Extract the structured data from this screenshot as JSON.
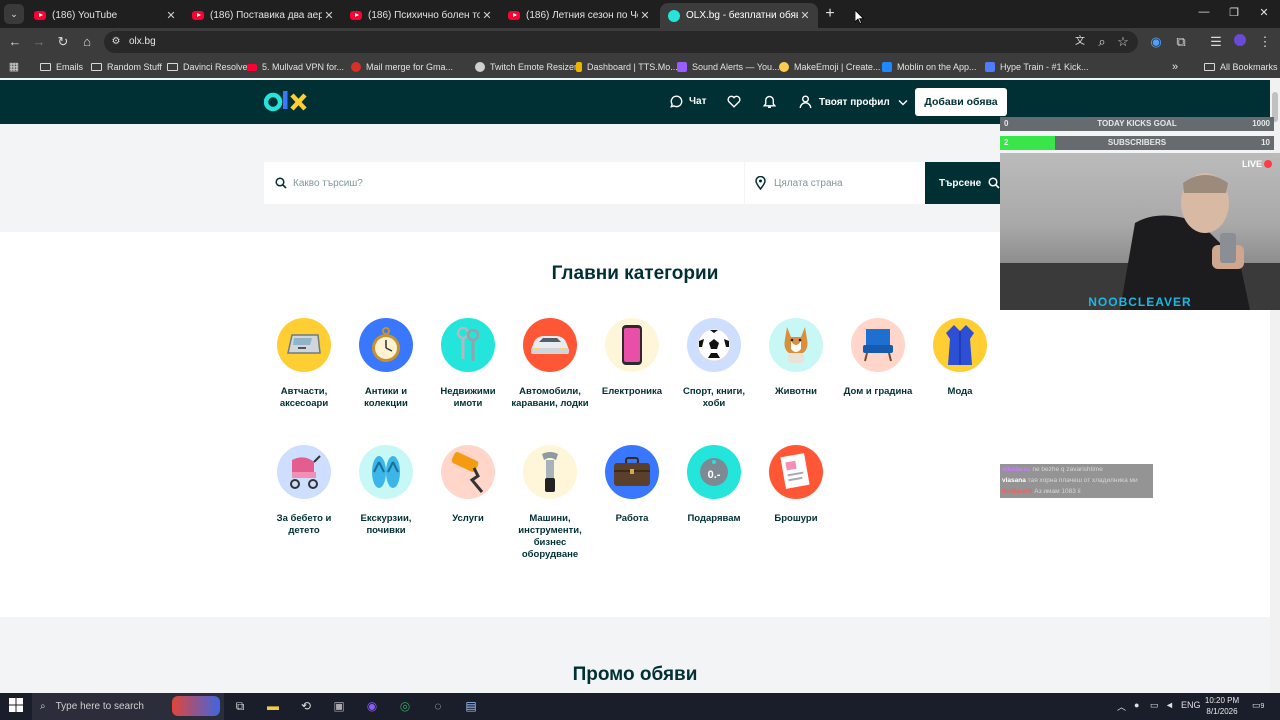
{
  "browser": {
    "tabs": [
      {
        "title": "(186) YouTube",
        "favicon": "youtube-icon",
        "active": false
      },
      {
        "title": "(186) Поставика два аератора",
        "favicon": "youtube-icon",
        "active": false
      },
      {
        "title": "(186) Психично болен тормоз",
        "favicon": "youtube-icon",
        "active": false
      },
      {
        "title": "(186) Летния сезон по Черноморието",
        "favicon": "youtube-icon",
        "active": false
      },
      {
        "title": "OLX.bg - безплатни обяви",
        "favicon": "olx-icon",
        "active": true
      }
    ],
    "new_tab": "+",
    "url": "olx.bg",
    "bookmarks": [
      {
        "label": "Emails",
        "icon": "folder-icon"
      },
      {
        "label": "Random Stuff",
        "icon": "folder-icon"
      },
      {
        "label": "Davinci Resolve",
        "icon": "folder-icon"
      },
      {
        "label": "5. Mullvad VPN for...",
        "icon": "youtube-icon"
      },
      {
        "label": "Mail merge for Gma...",
        "icon": "mail-merge-icon"
      },
      {
        "label": "Twitch Emote Resizer",
        "icon": "globe-icon"
      },
      {
        "label": "Dashboard | TTS.Mo...",
        "icon": "tts-icon"
      },
      {
        "label": "Sound Alerts — You...",
        "icon": "sound-alerts-icon"
      },
      {
        "label": "MakeEmoji | Create...",
        "icon": "emoji-icon"
      },
      {
        "label": "Moblin on the App...",
        "icon": "appstore-icon"
      },
      {
        "label": "Hype Train - #1 Kick...",
        "icon": "hype-train-icon"
      }
    ],
    "bookmarks_more": "»",
    "all_bookmarks": "All Bookmarks"
  },
  "olx": {
    "logo_text": "olx",
    "nav": {
      "chat": "Чат",
      "profile": "Твоят профил",
      "add_ad": "Добави обява"
    },
    "search": {
      "placeholder": "Какво търсиш?",
      "location_placeholder": "Цялата страна",
      "button": "Търсене"
    },
    "categories_title": "Главни категории",
    "categories": [
      {
        "label": "Автчасти, аксесоари",
        "icon": "car-door-icon",
        "bg": "#ffce32"
      },
      {
        "label": "Антики и колекции",
        "icon": "pocket-watch-icon",
        "bg": "#3a77ff"
      },
      {
        "label": "Недвижими имоти",
        "icon": "keys-icon",
        "bg": "#23e5db"
      },
      {
        "label": "Автомобили, каравани, лодки",
        "icon": "car-icon",
        "bg": "#ff5636"
      },
      {
        "label": "Електроника",
        "icon": "phone-icon",
        "bg": "#fff6d9"
      },
      {
        "label": "Спорт, книги, хоби",
        "icon": "football-icon",
        "bg": "#cedeff"
      },
      {
        "label": "Животни",
        "icon": "dog-icon",
        "bg": "#c8f8f6"
      },
      {
        "label": "Дом и градина",
        "icon": "armchair-icon",
        "bg": "#ffd6c9"
      },
      {
        "label": "Мода",
        "icon": "dress-icon",
        "bg": "#ffce32"
      },
      {
        "label": "За бебето и детето",
        "icon": "stroller-icon",
        "bg": "#cedeff"
      },
      {
        "label": "Екскурзии, почивки",
        "icon": "flip-flops-icon",
        "bg": "#c8f8f6"
      },
      {
        "label": "Услуги",
        "icon": "paint-roller-icon",
        "bg": "#ffd6c9"
      },
      {
        "label": "Машини, инструменти, бизнес оборудване",
        "icon": "wrench-icon",
        "bg": "#fff6d9"
      },
      {
        "label": "Работа",
        "icon": "briefcase-icon",
        "bg": "#3a77ff"
      },
      {
        "label": "Подарявам",
        "icon": "price-tag-icon",
        "bg": "#23e5db"
      },
      {
        "label": "Брошури",
        "icon": "brochure-icon",
        "bg": "#ff5636"
      }
    ],
    "promo_title": "Промо обяви"
  },
  "stream_overlay": {
    "kicks_goal": {
      "label": "TODAY KICKS GOAL",
      "current": "0",
      "target": "1000",
      "fraction": 0.0
    },
    "subscribers": {
      "label": "SUBSCRIBERS",
      "current": "2",
      "target": "10",
      "fraction": 0.2
    },
    "live_badge": "LIVE",
    "streamer_name": "NOOBCLEAVER",
    "chat": [
      {
        "user": "nikolaras",
        "message": "ne bezhe q zavarishtime",
        "color": "#c77dff"
      },
      {
        "user": "vlasana",
        "message": "тая хорна плачеш от хладилника ми",
        "color": "#ffffff"
      },
      {
        "user": "BeWareHI",
        "message": "Аз имам 1083 ii",
        "color": "#ff5b5b"
      }
    ]
  },
  "taskbar": {
    "search_placeholder": "Type here to search",
    "language": "ENG",
    "time": "10:20 PM",
    "date": "8/1/2026",
    "notifications": "9"
  }
}
